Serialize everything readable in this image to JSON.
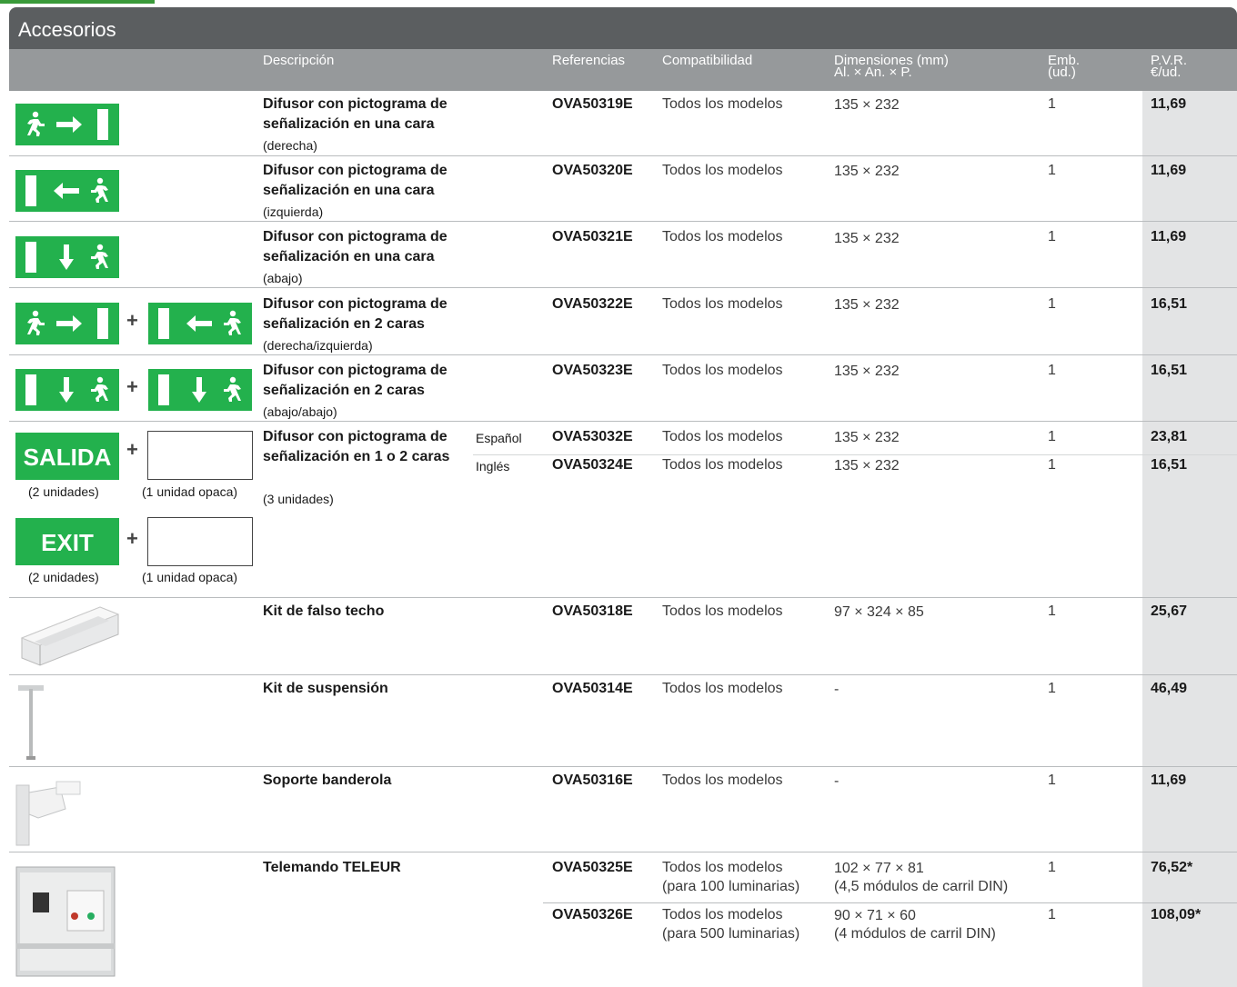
{
  "section_title": "Accesorios",
  "headers": {
    "desc": "Descripción",
    "ref": "Referencias",
    "compat": "Compatibilidad",
    "dim1": "Dimensiones (mm)",
    "dim2": "Al. × An. × P.",
    "emb1": "Emb.",
    "emb2": "(ud.)",
    "pvr1": "P.V.R.",
    "pvr2": "€/ud."
  },
  "rows": [
    {
      "desc": "Difusor con pictograma de señalización en una cara",
      "sub": "(derecha)",
      "ref": "OVA50319E",
      "compat": "Todos los modelos",
      "dim": "135 × 232",
      "emb": "1",
      "price": "11,69"
    },
    {
      "desc": "Difusor con pictograma de señalización en una cara",
      "sub": "(izquierda)",
      "ref": "OVA50320E",
      "compat": "Todos los modelos",
      "dim": "135 × 232",
      "emb": "1",
      "price": "11,69"
    },
    {
      "desc": "Difusor con pictograma de señalización en una cara",
      "sub": "(abajo)",
      "ref": "OVA50321E",
      "compat": "Todos los modelos",
      "dim": "135 × 232",
      "emb": "1",
      "price": "11,69"
    },
    {
      "desc": "Difusor con pictograma de señalización en 2 caras",
      "sub": "(derecha/izquierda)",
      "ref": "OVA50322E",
      "compat": "Todos los modelos",
      "dim": "135 × 232",
      "emb": "1",
      "price": "16,51"
    },
    {
      "desc": "Difusor con pictograma de señalización en 2 caras",
      "sub": "(abajo/abajo)",
      "ref": "OVA50323E",
      "compat": "Todos los modelos",
      "dim": "135 × 232",
      "emb": "1",
      "price": "16,51"
    },
    {
      "desc": "Difusor con pictograma de señalización en 1 o 2 caras",
      "sub": "(3 unidades)",
      "lang1": "Español",
      "ref1": "OVA53032E",
      "compat1": "Todos los modelos",
      "dim1": "135 × 232",
      "emb1": "1",
      "price1": "23,81",
      "lang2": "Inglés",
      "ref2": "OVA50324E",
      "compat2": "Todos los modelos",
      "dim2": "135 × 232",
      "emb2": "1",
      "price2": "16,51",
      "sign1": "SALIDA",
      "sign2": "EXIT",
      "cap_units": "(2 unidades)",
      "cap_opaque": "(1 unidad opaca)",
      "plus": "+"
    },
    {
      "desc": "Kit de falso techo",
      "ref": "OVA50318E",
      "compat": "Todos los modelos",
      "dim": "97 × 324 × 85",
      "emb": "1",
      "price": "25,67"
    },
    {
      "desc": "Kit de suspensión",
      "ref": "OVA50314E",
      "compat": "Todos los modelos",
      "dim": "-",
      "emb": "1",
      "price": "46,49"
    },
    {
      "desc": "Soporte banderola",
      "ref": "OVA50316E",
      "compat": "Todos los modelos",
      "dim": "-",
      "emb": "1",
      "price": "11,69"
    },
    {
      "desc": "Telemando TELEUR",
      "ref1": "OVA50325E",
      "compat1a": "Todos los modelos",
      "compat1b": "(para 100 luminarias)",
      "dim1a": "102 × 77 × 81",
      "dim1b": "(4,5 módulos de carril DIN)",
      "emb1": "1",
      "price1": "76,52*",
      "ref2": "OVA50326E",
      "compat2a": "Todos los modelos",
      "compat2b": "(para 500 luminarias)",
      "dim2a": "90 × 71 × 60",
      "dim2b": "(4 módulos de carril DIN)",
      "emb2": "1",
      "price2": "108,09*"
    }
  ],
  "colors": {
    "title_bar": "#5b5e60",
    "header_row": "#96999b",
    "price_col": "#e3e4e5",
    "sign_green": "#23b14d"
  }
}
